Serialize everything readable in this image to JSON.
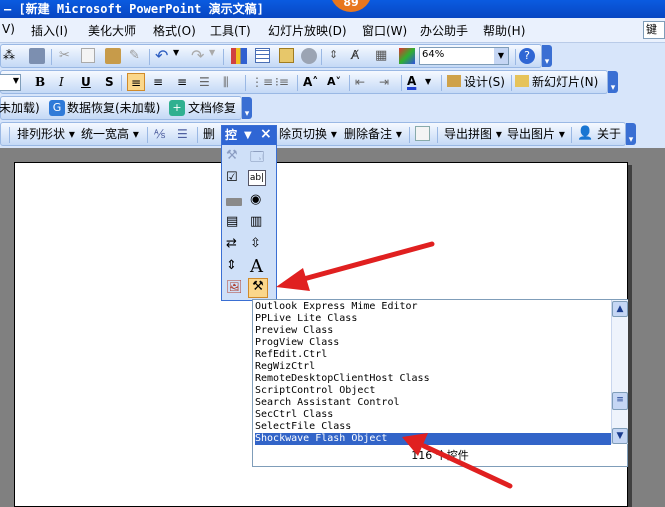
{
  "titlebar": {
    "title": "– [新建 Microsoft PowerPoint 演示文稿]",
    "badge": "89"
  },
  "menu": {
    "items": [
      "V)",
      "插入(I)",
      "美化大师",
      "格式(O)",
      "工具(T)",
      "幻灯片放映(D)",
      "窗口(W)",
      "办公助手",
      "帮助(H)"
    ],
    "search_value": "键入"
  },
  "standard_toolbar": {
    "zoom": "64%"
  },
  "format_toolbar": {
    "design": "设计(S)",
    "new_slide": "新幻灯片(N)"
  },
  "addin_toolbar": {
    "item1": "未加载)",
    "item2": "数据恢复(未加载)",
    "item3": "文档修复"
  },
  "tools_toolbar": {
    "arrange": "排列形状",
    "unify": "统一宽高",
    "del1": "删",
    "del_switch": "除页切换",
    "del_notes": "删除备注",
    "export_img": "导出拼图",
    "export_pic": "导出图片",
    "about": "关于"
  },
  "palette": {
    "title": "控",
    "close": "×"
  },
  "listbox": {
    "items": [
      "Outlook Express Mime Editor",
      "PPLive Lite Class",
      "Preview Class",
      "ProgView Class",
      "RefEdit.Ctrl",
      "RegWizCtrl",
      "RemoteDesktopClientHost Class",
      "ScriptControl Object",
      "Search Assistant Control",
      "SecCtrl Class",
      "SelectFile Class",
      "Shockwave Flash Object"
    ],
    "count": "116 个控件"
  },
  "colors": {
    "title_blue": "#0a5be0",
    "selected": "#3264c8",
    "arrow_red": "#e02020"
  }
}
